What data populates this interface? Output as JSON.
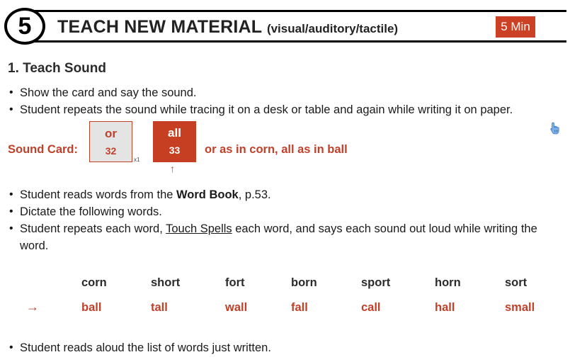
{
  "header": {
    "number": "5",
    "title": "TEACH NEW MATERIAL",
    "subtitle": "(visual/auditory/tactile)",
    "badge": "5 Min"
  },
  "section_title": "1. Teach Sound",
  "bullets_a": [
    "Show the card and say the sound.",
    "Student repeats the sound while tracing it on a desk or table and again while writing it on paper."
  ],
  "sound_card": {
    "label": "Sound Card:",
    "cards": [
      {
        "word": "or",
        "number": "32"
      },
      {
        "word": "all",
        "number": "33"
      }
    ],
    "note": "x1",
    "arrow": "↑",
    "description": "or as in corn, all as in ball"
  },
  "bullets_b": {
    "item1_pre": "Student reads words from the ",
    "item1_bold": "Word Book",
    "item1_post": ", p.53.",
    "item2": "Dictate the following words.",
    "item3_pre": "Student repeats each word, ",
    "item3_link": "Touch Spells",
    "item3_post": " each word, and says each sound out loud while writing the word."
  },
  "word_rows": {
    "arrow": "→",
    "row1": [
      "corn",
      "short",
      "fort",
      "born",
      "sport",
      "horn",
      "sort"
    ],
    "row2": [
      "ball",
      "tall",
      "wall",
      "fall",
      "call",
      "hall",
      "small"
    ]
  },
  "bullets_c": [
    "Student reads aloud the list of words just written."
  ],
  "colors": {
    "accent": "#cc4125",
    "card_light": "#e4e4e4",
    "text": "#1a1a1a"
  }
}
